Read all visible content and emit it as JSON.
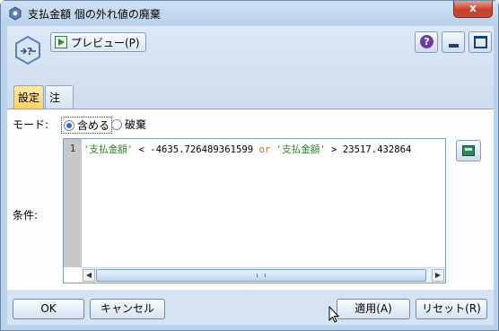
{
  "window": {
    "title": "支払金額 個の外れ値の廃棄",
    "close_label": "x"
  },
  "toolbar": {
    "preview_label": "プレビュー(P)",
    "help_label": "?"
  },
  "tabs": [
    {
      "label": "設定",
      "active": true
    },
    {
      "label": "注釈",
      "active": false
    }
  ],
  "settings": {
    "mode_label": "モード:",
    "options": [
      {
        "label": "含める",
        "selected": true
      },
      {
        "label": "破棄",
        "selected": false
      }
    ],
    "condition_label": "条件:",
    "line_number": "1",
    "expression": {
      "part1": "'支払金額'",
      "part2": " < -4635.726489361599 ",
      "keyword": "or",
      "part3": " ",
      "part4": "'支払金額'",
      "part5": " > 23517.432864"
    }
  },
  "buttons": {
    "ok": "OK",
    "cancel": "キャンセル",
    "apply": "適用(A)",
    "reset": "リセット(R)"
  }
}
